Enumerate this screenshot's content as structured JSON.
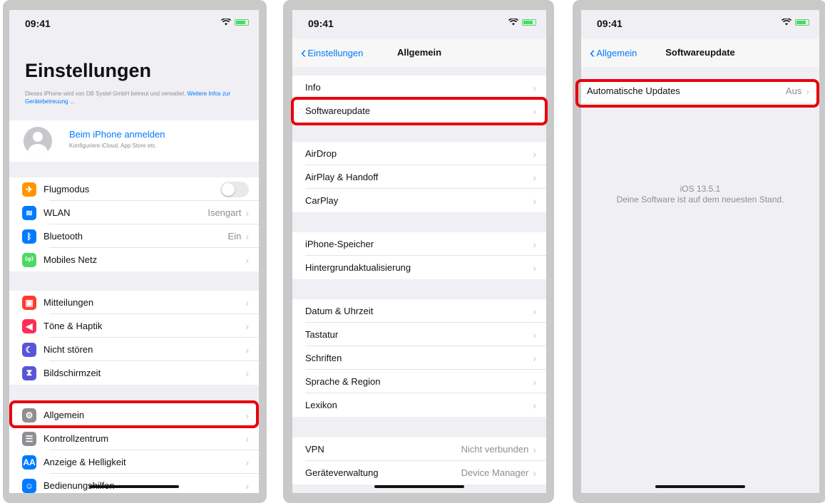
{
  "status": {
    "time": "09:41"
  },
  "screen1": {
    "title": "Einstellungen",
    "management_text": "Dieses iPhone wird von DB Systel GmbH betreut und verwaltet.",
    "management_link": "Weitere Infos zur Gerätebetreuung ...",
    "account_title": "Beim iPhone anmelden",
    "account_subtitle": "Konfiguriere iCloud, App Store etc.",
    "group1": [
      {
        "label": "Flugmodus",
        "icon": "airplane-icon",
        "color": "#ff9500",
        "glyph": "✈",
        "toggle": "off"
      },
      {
        "label": "WLAN",
        "value": "Isengart",
        "icon": "wifi-icon",
        "color": "#007aff",
        "glyph": "≋"
      },
      {
        "label": "Bluetooth",
        "value": "Ein",
        "icon": "bluetooth-icon",
        "color": "#007aff",
        "glyph": "ᛒ"
      },
      {
        "label": "Mobiles Netz",
        "icon": "antenna-icon",
        "color": "#4cd964",
        "glyph": "⁽ᵠ⁾"
      }
    ],
    "group2": [
      {
        "label": "Mitteilungen",
        "icon": "notifications-icon",
        "color": "#ff3b30",
        "glyph": "▣"
      },
      {
        "label": "Töne & Haptik",
        "icon": "speaker-icon",
        "color": "#ff2d55",
        "glyph": "◀"
      },
      {
        "label": "Nicht stören",
        "icon": "moon-icon",
        "color": "#5856d6",
        "glyph": "☾"
      },
      {
        "label": "Bildschirmzeit",
        "icon": "hourglass-icon",
        "color": "#5856d6",
        "glyph": "⧗"
      }
    ],
    "group3": [
      {
        "label": "Allgemein",
        "icon": "gear-icon",
        "color": "#8e8e93",
        "glyph": "⚙"
      },
      {
        "label": "Kontrollzentrum",
        "icon": "switches-icon",
        "color": "#8e8e93",
        "glyph": "☰"
      },
      {
        "label": "Anzeige & Helligkeit",
        "icon": "brightness-icon",
        "color": "#007aff",
        "glyph": "AA"
      },
      {
        "label": "Bedienungshilfen",
        "icon": "accessibility-icon",
        "color": "#007aff",
        "glyph": "☺"
      }
    ]
  },
  "screen2": {
    "back_label": "Einstellungen",
    "title": "Allgemein",
    "groups": [
      [
        {
          "label": "Info"
        },
        {
          "label": "Softwareupdate"
        }
      ],
      [
        {
          "label": "AirDrop"
        },
        {
          "label": "AirPlay & Handoff"
        },
        {
          "label": "CarPlay"
        }
      ],
      [
        {
          "label": "iPhone-Speicher"
        },
        {
          "label": "Hintergrundaktualisierung"
        }
      ],
      [
        {
          "label": "Datum & Uhrzeit"
        },
        {
          "label": "Tastatur"
        },
        {
          "label": "Schriften"
        },
        {
          "label": "Sprache & Region"
        },
        {
          "label": "Lexikon"
        }
      ],
      [
        {
          "label": "VPN",
          "value": "Nicht verbunden"
        },
        {
          "label": "Geräteverwaltung",
          "value": "Device Manager"
        }
      ]
    ]
  },
  "screen3": {
    "back_label": "Allgemein",
    "title": "Softwareupdate",
    "row_label": "Automatische Updates",
    "row_value": "Aus",
    "ios_version": "iOS 13.5.1",
    "status_text": "Deine Software ist auf dem neuesten Stand."
  },
  "colors": {
    "highlight": "#e8000b",
    "accent": "#007aff",
    "background": "#efeff4"
  }
}
